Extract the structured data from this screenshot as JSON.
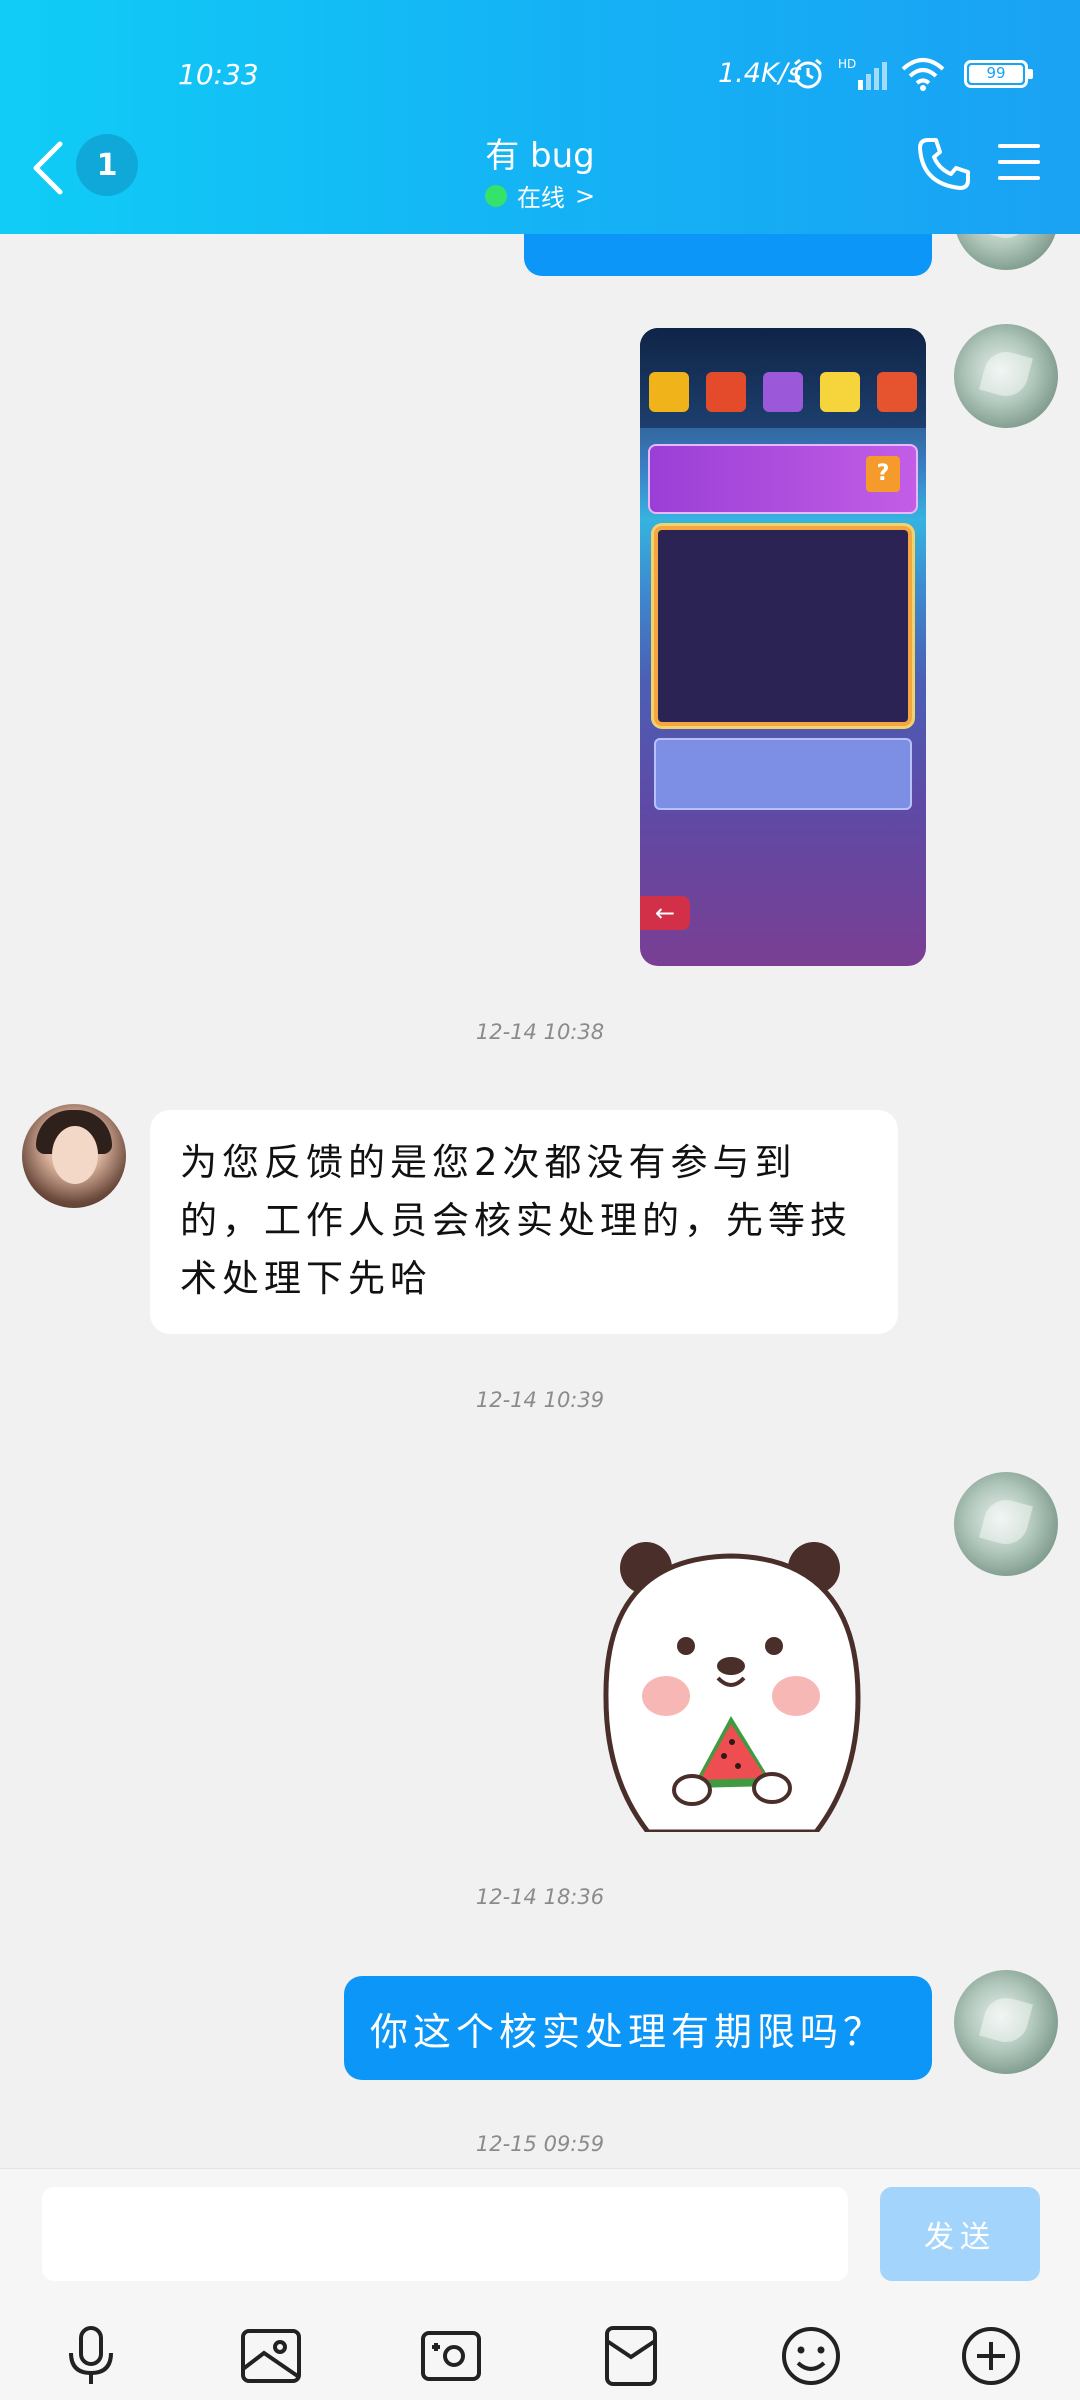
{
  "status_bar": {
    "time": "10:33",
    "network_speed": "1.4K/s",
    "signal_label": "HD",
    "battery": "99"
  },
  "header": {
    "unread_count": "1",
    "contact_name": "有 bug",
    "presence": "在线",
    "presence_chevron": ">"
  },
  "chat": {
    "top_partial_bubble": "",
    "timestamps": [
      "12-14 10:38",
      "12-14 10:39",
      "12-14 18:36",
      "12-15 09:59"
    ],
    "messages": [
      {
        "from": "me",
        "type": "image",
        "content": "game screenshot"
      },
      {
        "from": "agent",
        "type": "text",
        "text": "为您反馈的是您2次都没有参与到的，工作人员会核实处理的，先等技术处理下先哈"
      },
      {
        "from": "me",
        "type": "sticker",
        "content": "panda eating watermelon"
      },
      {
        "from": "me",
        "type": "text",
        "text": "你这个核实处理有期限吗？"
      }
    ]
  },
  "input": {
    "value": "",
    "placeholder": "",
    "send_label": "发送"
  },
  "toolbar": {
    "icons": [
      "microphone-icon",
      "image-icon",
      "camera-icon",
      "red-packet-icon",
      "emoji-icon",
      "plus-icon"
    ]
  },
  "colors": {
    "header_gradient_start": "#10cdf6",
    "header_gradient_end": "#1aa2f3",
    "my_bubble": "#0c96f7",
    "send_button_disabled": "#a3d4fc",
    "online_dot": "#36e36a"
  }
}
